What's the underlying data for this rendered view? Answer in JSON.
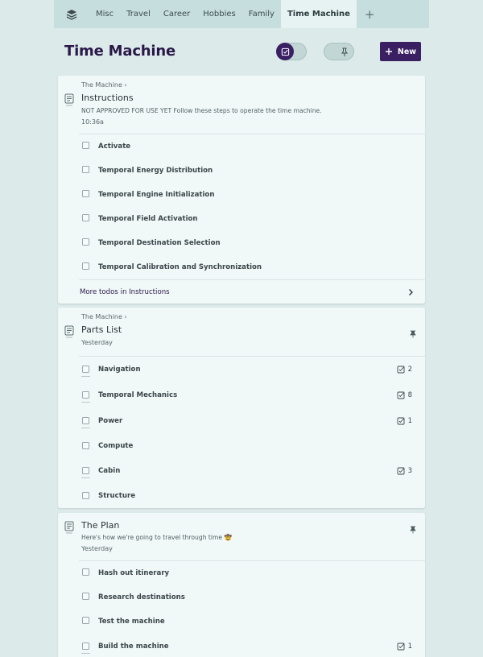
{
  "tabs": {
    "items": [
      "Misc",
      "Travel",
      "Career",
      "Hobbies",
      "Family",
      "Time Machine"
    ],
    "active": "Time Machine",
    "add_label": "+"
  },
  "header": {
    "title": "Time Machine",
    "new_button": "New"
  },
  "cards": [
    {
      "breadcrumb": "The Machine ›",
      "title": "Instructions",
      "description": "NOT APPROVED FOR USE YET Follow these steps to operate the time machine.",
      "time": "10:36a",
      "pinned": false,
      "todos": [
        {
          "label": "Activate"
        },
        {
          "label": "Temporal Energy Distribution"
        },
        {
          "label": "Temporal Engine Initialization"
        },
        {
          "label": "Temporal Field Activation"
        },
        {
          "label": "Temporal Destination Selection"
        },
        {
          "label": "Temporal Calibration and Synchronization"
        }
      ],
      "more": "More todos in Instructions"
    },
    {
      "breadcrumb": "The Machine ›",
      "title": "Parts List",
      "time": "Yesterday",
      "pinned": true,
      "todos": [
        {
          "label": "Navigation",
          "count": "2"
        },
        {
          "label": "Temporal Mechanics",
          "count": "8"
        },
        {
          "label": "Power",
          "count": "1"
        },
        {
          "label": "Compute"
        },
        {
          "label": "Cabin",
          "count": "3"
        },
        {
          "label": "Structure"
        }
      ]
    },
    {
      "title": "The Plan",
      "description": "Here's how we're going to travel through time 🤠",
      "time": "Yesterday",
      "pinned": true,
      "todos": [
        {
          "label": "Hash out itinerary"
        },
        {
          "label": "Research destinations"
        },
        {
          "label": "Test the machine"
        },
        {
          "label": "Build the machine",
          "count": "1"
        }
      ]
    }
  ],
  "colors": {
    "accent": "#3a1f63",
    "background": "#dcebea",
    "card": "#f1f8f8",
    "tabbar": "#c6dedd"
  }
}
